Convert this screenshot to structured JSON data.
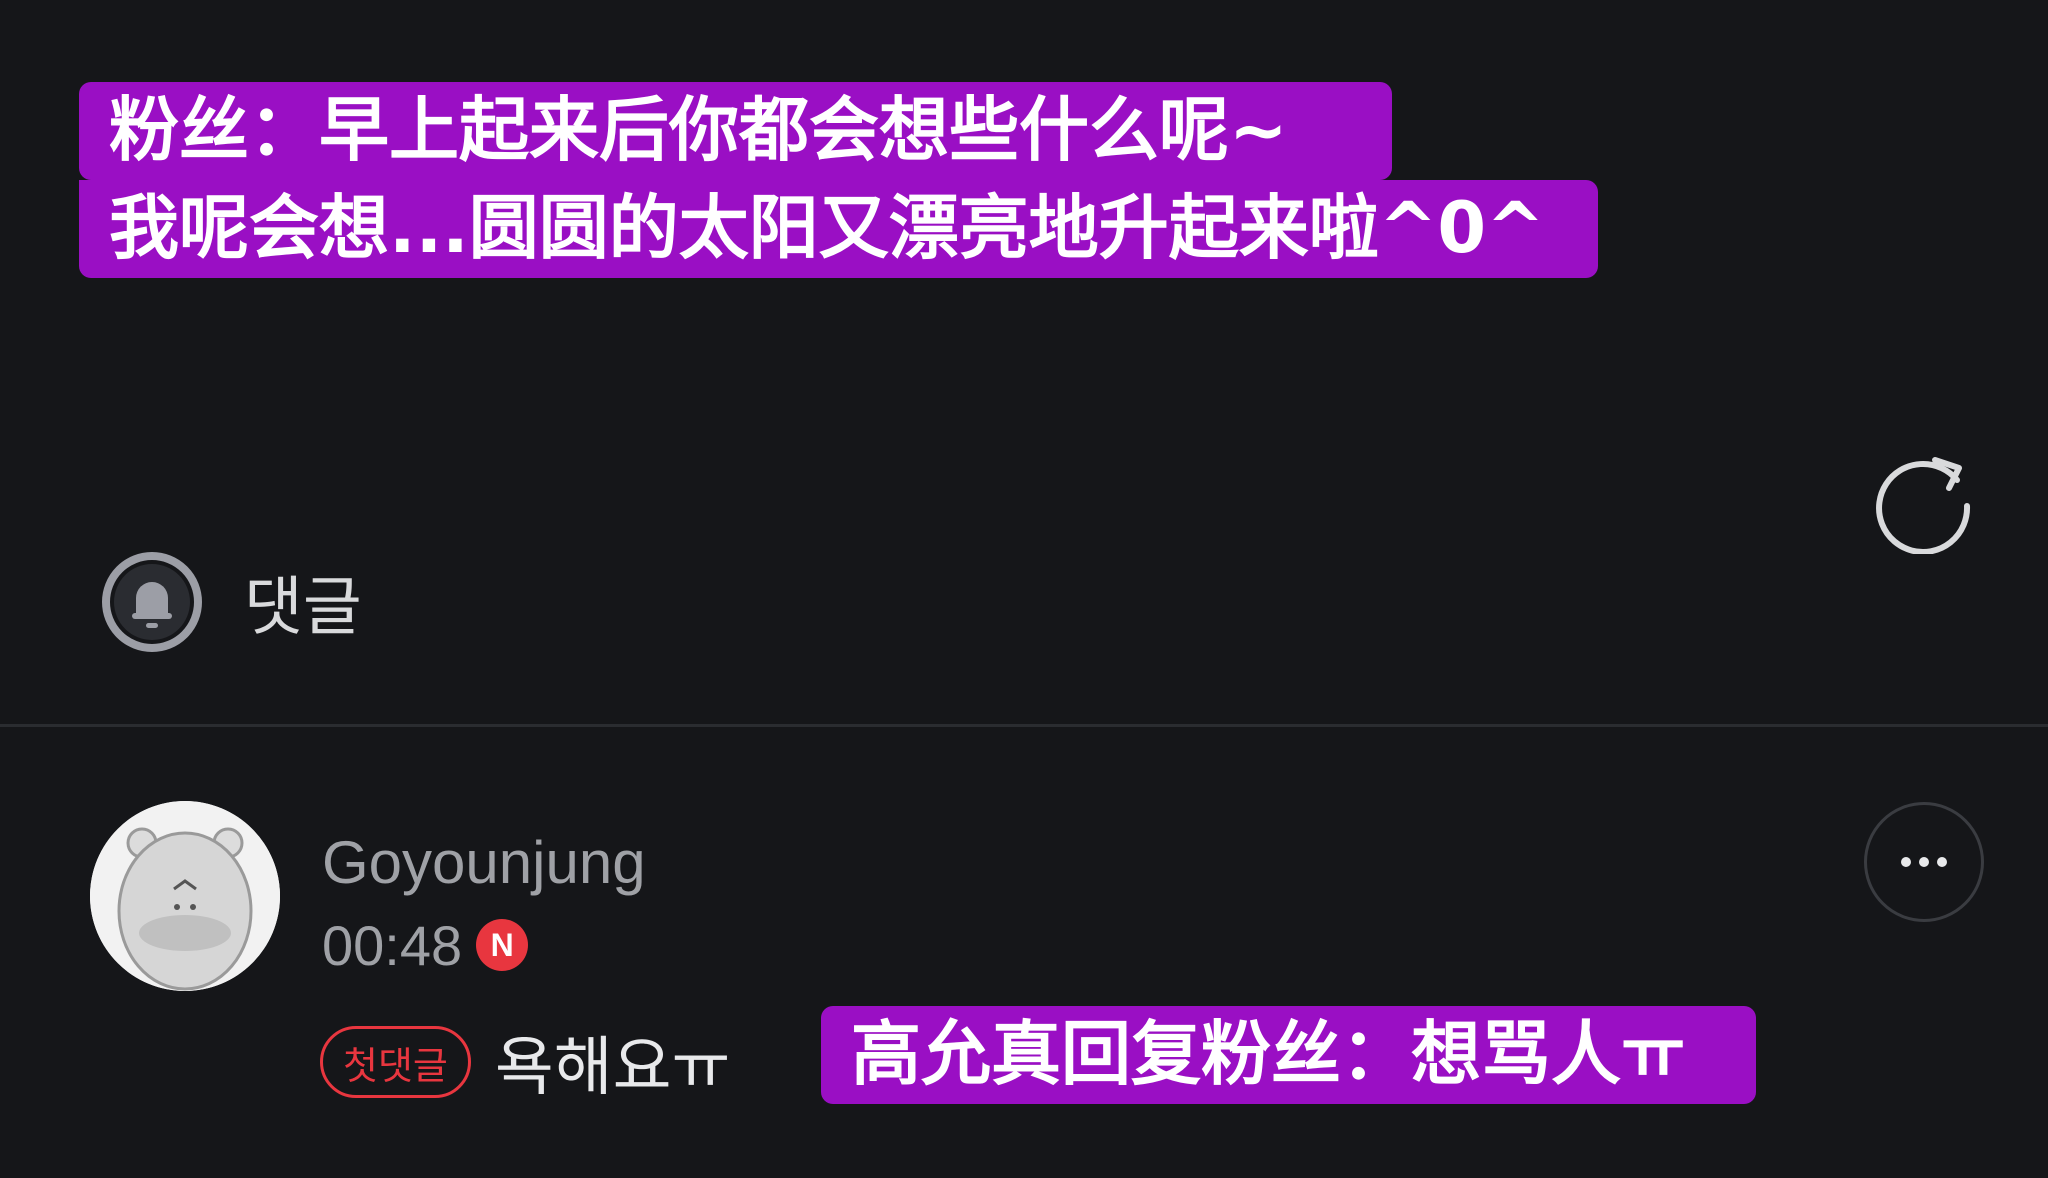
{
  "captions": {
    "line1": "粉丝：早上起来后你都会想些什么呢~",
    "line2": "我呢会想...圆圆的太阳又漂亮地升起来啦^0^",
    "reply": "高允真回复粉丝：想骂人ㅠ"
  },
  "comments_section": {
    "title": "댓글"
  },
  "comment": {
    "username": "Goyounjung",
    "time": "00:48",
    "new_badge": "N",
    "first_comment_badge": "첫댓글",
    "text": "욕해요ㅠ"
  },
  "icons": {
    "refresh": "refresh-icon",
    "bell": "bell-icon",
    "more": "more-icon",
    "avatar": "hamster-avatar"
  },
  "colors": {
    "background": "#151619",
    "caption_bg": "#9a0fc4",
    "accent_red": "#e8363f",
    "muted_text": "#9fa1a6"
  }
}
